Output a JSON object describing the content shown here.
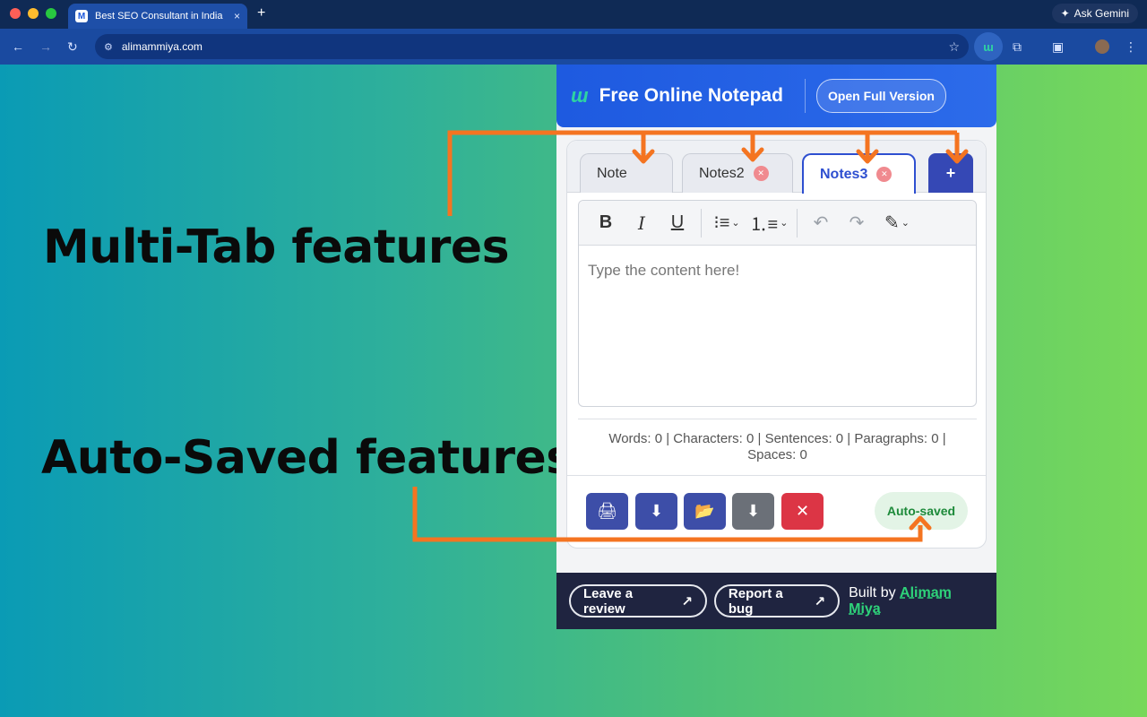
{
  "browser": {
    "tab_title": "Best SEO Consultant in India",
    "tab_close": "×",
    "new_tab": "+",
    "url": "alimammiya.com",
    "ask_gemini": "Ask Gemini",
    "favicon": "M"
  },
  "promo": {
    "line1": "Multi-Tab features",
    "line2": "Auto-Saved features"
  },
  "header": {
    "logo": "u",
    "title": "Free Online Notepad",
    "open_full": "Open Full Version"
  },
  "tabs": [
    {
      "label": "Note",
      "closable": false
    },
    {
      "label": "Notes2",
      "closable": true
    },
    {
      "label": "Notes3",
      "closable": true,
      "active": true
    }
  ],
  "add_tab": "+",
  "toolbar": {
    "bold": "B",
    "italic": "I",
    "underline": "U"
  },
  "editor": {
    "placeholder": "Type the content here!"
  },
  "stats": {
    "line1": "Words: 0 | Characters: 0 | Sentences: 0 | Paragraphs: 0 |",
    "line2": "Spaces: 0"
  },
  "actions": {
    "autosaved": "Auto-saved"
  },
  "footer": {
    "review": "Leave a review",
    "bug": "Report a bug",
    "arrow": "↗",
    "built_by": "Built by",
    "author": "Alimam Miya"
  },
  "colors": {
    "accent": "#2e4fd0",
    "annotation": "#f47421",
    "autosave": "#1d8a3a",
    "danger": "#dc3545"
  }
}
